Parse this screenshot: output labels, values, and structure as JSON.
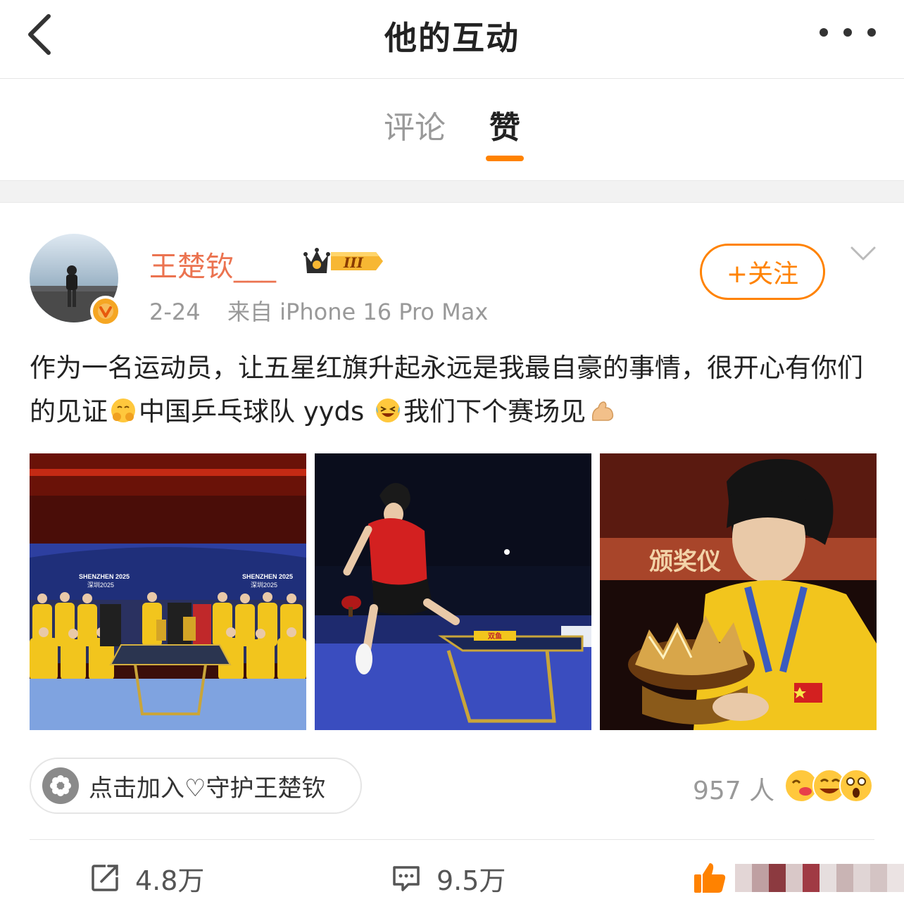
{
  "header": {
    "title": "他的互动"
  },
  "tabs": [
    {
      "label": "评论",
      "active": false
    },
    {
      "label": "赞",
      "active": true
    }
  ],
  "colors": {
    "accent": "#ff8200",
    "username": "#eb7350",
    "meta": "#999999"
  },
  "post": {
    "author": {
      "name": "王楚钦___",
      "badge": "III"
    },
    "date": "2-24",
    "source": "来自 iPhone 16 Pro Max",
    "follow_label": "+关注",
    "text_part1": "作为一名运动员，让五星红旗升起永远是我最自豪的事情，很开心有你们的见证",
    "text_part2": "中国乒乓球队 yyds ",
    "text_part3": "我们下个赛场见",
    "images": [
      {
        "banner_left": "SHENZHEN 2025",
        "banner_left_sub": "深圳2025",
        "banner_right": "SHENZHEN 2025",
        "banner_right_sub": "深圳2025"
      },
      {
        "brand": "双鱼"
      },
      {
        "banner": "颁奖仪"
      }
    ],
    "fan_club_label": "点击加入♡守护王楚钦",
    "reaction_count": "957 人",
    "reposts": "4.8万",
    "comments": "9.5万"
  }
}
